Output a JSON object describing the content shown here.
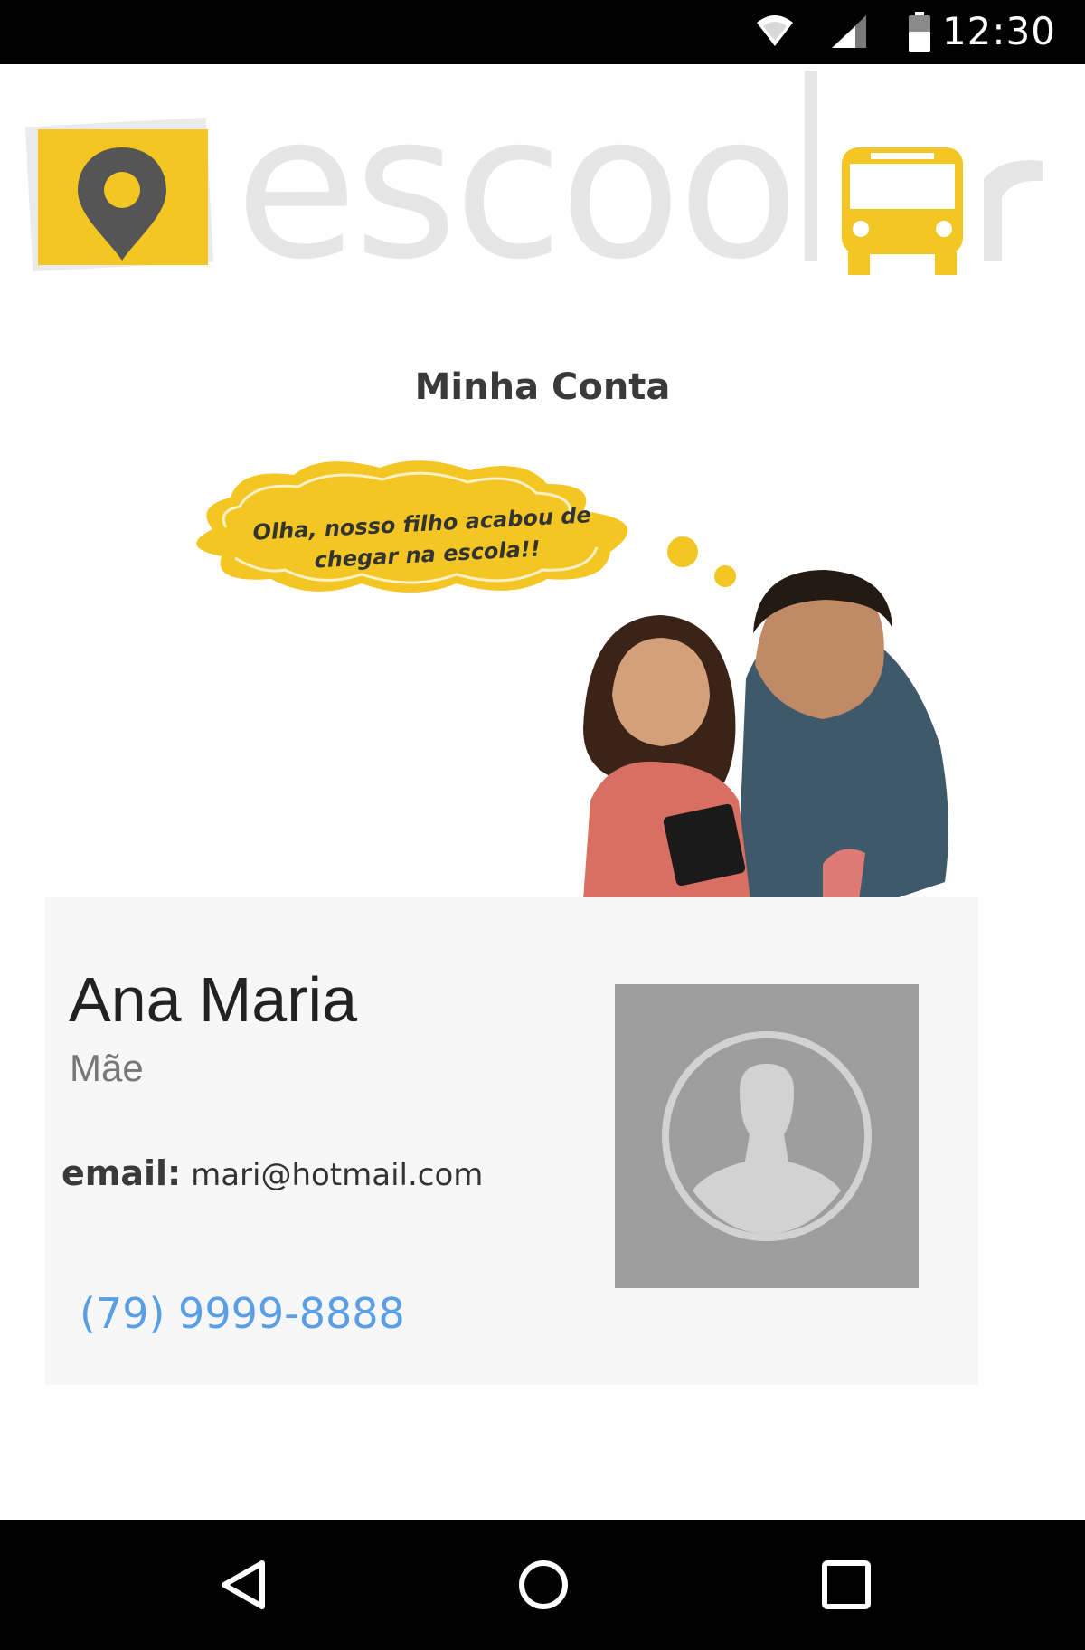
{
  "status_bar": {
    "time": "12:30",
    "icons": [
      "wifi-icon",
      "cell-signal-icon",
      "battery-icon"
    ]
  },
  "logo": {
    "text": "escoolar",
    "icons": [
      "map-pin-icon",
      "school-bus-icon"
    ]
  },
  "page": {
    "title": "Minha Conta"
  },
  "hero": {
    "bubble_line1": "Olha, nosso filho acabou de",
    "bubble_line2": "chegar na escola!!"
  },
  "profile": {
    "name": "Ana Maria",
    "role": "Mãe",
    "email_label": "email:",
    "email": "mari@hotmail.com",
    "phone": "(79) 9999-8888",
    "avatar_icon": "default-user-icon"
  },
  "nav_bar": {
    "buttons": [
      "back-icon",
      "home-icon",
      "recents-icon"
    ]
  },
  "colors": {
    "brand_yellow": "#f3c623",
    "logo_grey": "#e6e6e6",
    "pin_grey": "#555555",
    "link_blue": "#5a9ee6",
    "card_bg": "#f7f7f7",
    "avatar_bg": "#9e9e9e",
    "system_bar": "#000000"
  }
}
